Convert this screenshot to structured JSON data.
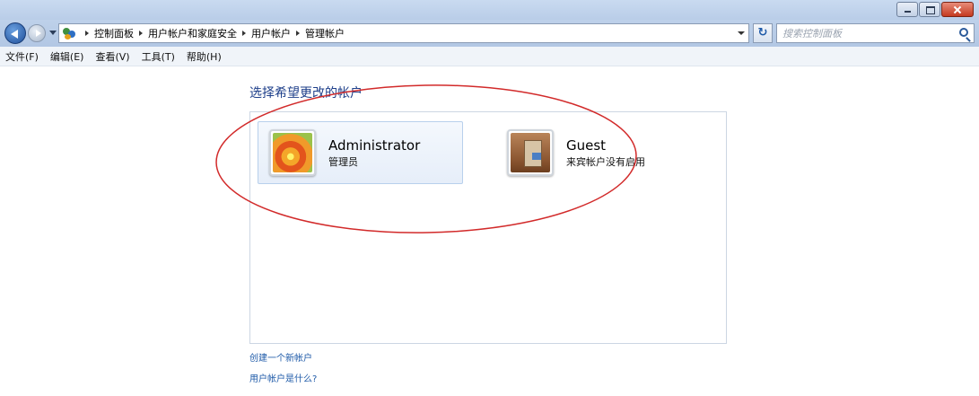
{
  "window": {
    "controls": [
      "minimize",
      "maximize",
      "close"
    ]
  },
  "nav": {
    "breadcrumbs": [
      "控制面板",
      "用户帐户和家庭安全",
      "用户帐户",
      "管理帐户"
    ],
    "search_placeholder": "搜索控制面板"
  },
  "menu": {
    "items": [
      "文件(F)",
      "编辑(E)",
      "查看(V)",
      "工具(T)",
      "帮助(H)"
    ]
  },
  "main": {
    "heading": "选择希望更改的帐户",
    "accounts": [
      {
        "name": "Administrator",
        "description": "管理员",
        "picture": "flower-picture",
        "selected": true
      },
      {
        "name": "Guest",
        "description": "来宾帐户没有启用",
        "picture": "briefcase-picture",
        "selected": false
      }
    ],
    "links": [
      "创建一个新帐户",
      "用户帐户是什么?"
    ]
  },
  "colors": {
    "link": "#1e5aa8",
    "heading": "#1e3f8a",
    "annotation_ellipse": "#d22a2a"
  }
}
